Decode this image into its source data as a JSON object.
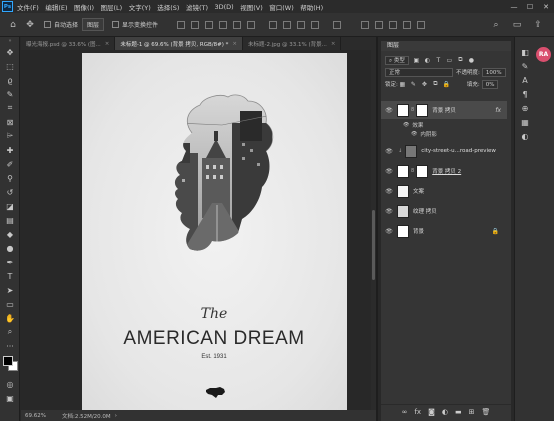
{
  "app": {
    "logo_text": "Ps"
  },
  "menu": [
    "文件(F)",
    "编辑(E)",
    "图像(I)",
    "图层(L)",
    "文字(Y)",
    "选择(S)",
    "滤镜(T)",
    "3D(D)",
    "视图(V)",
    "窗口(W)",
    "帮助(H)"
  ],
  "window_controls": {
    "minimize": "—",
    "maximize": "☐",
    "close": "✕"
  },
  "options": {
    "auto_select_label": "自动选择",
    "auto_select_value": "图层",
    "transform_label": "显示变换控件"
  },
  "tabs": [
    {
      "label": "曝光海报.psd @ 33.6% (图...",
      "close": "×",
      "active": false
    },
    {
      "label": "未标题-1 @ 69.6% (背景 拷贝, RGB/8#) *",
      "close": "×",
      "active": true
    },
    {
      "label": "未标题-2.jpg @ 33.1% (背景...",
      "close": "×",
      "active": false
    }
  ],
  "poster": {
    "script_title": "The",
    "main_title": "AMERICAN DREAM",
    "subtitle": "Est. 1931"
  },
  "status": {
    "zoom": "69.62%",
    "doc_info": "文档:2.52M/20.0M",
    "arrow": "›"
  },
  "layers_panel": {
    "tab_label": "图层",
    "filter_label": "类型",
    "blend_mode": "正常",
    "opacity_label": "不透明度:",
    "opacity_value": "100%",
    "lock_label": "锁定:",
    "fill_label": "填充:",
    "fill_value": "0%",
    "layers": [
      {
        "name": "背景 拷贝",
        "fx": "fx",
        "selected": true
      },
      {
        "name": "city-street-u...road-preview",
        "selected": false
      },
      {
        "name": "背景 拷贝 2",
        "selected": false
      },
      {
        "name": "文案",
        "selected": false
      },
      {
        "name": "纹理 拷贝",
        "selected": false
      },
      {
        "name": "背景",
        "selected": false
      }
    ],
    "effects_label": "效果",
    "inner_shadow_label": "内阴影"
  },
  "user": {
    "initials": "RA"
  },
  "icons": {
    "eye": "eye-icon",
    "fx": "fx-icon",
    "lock": "lock-icon",
    "link": "link-icon",
    "mask": "mask-icon",
    "trash": "trash-icon",
    "new_layer": "new-layer-icon",
    "folder": "folder-icon",
    "adjust": "adjustment-icon"
  },
  "colors": {
    "accent": "#31a8ff",
    "avatar": "#d94f6e"
  }
}
